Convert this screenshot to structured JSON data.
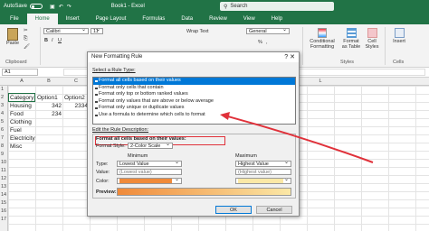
{
  "titlebar": {
    "autosave": "AutoSave",
    "toggle_state": "Off",
    "document": "Book1 - Excel",
    "search": "Search"
  },
  "tabs": [
    "File",
    "Home",
    "Insert",
    "Page Layout",
    "Formulas",
    "Data",
    "Review",
    "View",
    "Help"
  ],
  "ribbon": {
    "paste": "Paste",
    "clipboard": "Clipboard",
    "font_name": "Calibri",
    "font_size": "11",
    "wrap_text": "Wrap Text",
    "number_format": "General",
    "conditional_formatting": "Conditional Formatting",
    "format_as_table": "Format as Table",
    "cell_styles": "Cell Styles",
    "styles_group": "Styles",
    "insert": "Insert",
    "cells_group": "Cells"
  },
  "formula_bar": {
    "name_box": "A1"
  },
  "columns": [
    "A",
    "B",
    "C",
    "D",
    "E",
    "F",
    "G",
    "H",
    "I",
    "J",
    "K",
    "L"
  ],
  "rows": [
    "1",
    "2",
    "3",
    "4",
    "5",
    "6",
    "7",
    "8",
    "9",
    "10",
    "11",
    "12",
    "13",
    "14",
    "15",
    "16",
    "17"
  ],
  "sheet": {
    "headers": [
      "Category",
      "Option1",
      "Option2"
    ],
    "data": [
      {
        "category": "Housing",
        "option1": "342",
        "option2": "2334"
      },
      {
        "category": "Food",
        "option1": "234",
        "option2": ""
      },
      {
        "category": "Clothing",
        "option1": "",
        "option2": ""
      },
      {
        "category": "Fuel",
        "option1": "",
        "option2": ""
      },
      {
        "category": "Electricity",
        "option1": "",
        "option2": ""
      },
      {
        "category": "Misc",
        "option1": "",
        "option2": ""
      }
    ]
  },
  "dialog": {
    "title": "New Formatting Rule",
    "close": "?  ✕",
    "select_label": "Select a Rule Type:",
    "rule_types": [
      "Format all cells based on their values",
      "Format only cells that contain",
      "Format only top or bottom ranked values",
      "Format only values that are above or below average",
      "Format only unique or duplicate values",
      "Use a formula to determine which cells to format"
    ],
    "edit_label": "Edit the Rule Description:",
    "desc_heading": "Format all cells based on their values:",
    "format_style_label": "Format Style:",
    "format_style_value": "2-Color Scale",
    "minimum_label": "Minimum",
    "maximum_label": "Maximum",
    "type_label": "Type:",
    "min_type": "Lowest Value",
    "max_type": "Highest Value",
    "value_label": "Value:",
    "min_value": "(Lowest value)",
    "max_value": "(Highest value)",
    "color_label": "Color:",
    "min_color": "#f08a3a",
    "max_color": "#fbe8a6",
    "preview_label": "Preview:",
    "ok": "OK",
    "cancel": "Cancel"
  },
  "colors": {
    "excel_green": "#217346",
    "selection_blue": "#0078d7",
    "annotation_red": "#e0313a"
  }
}
